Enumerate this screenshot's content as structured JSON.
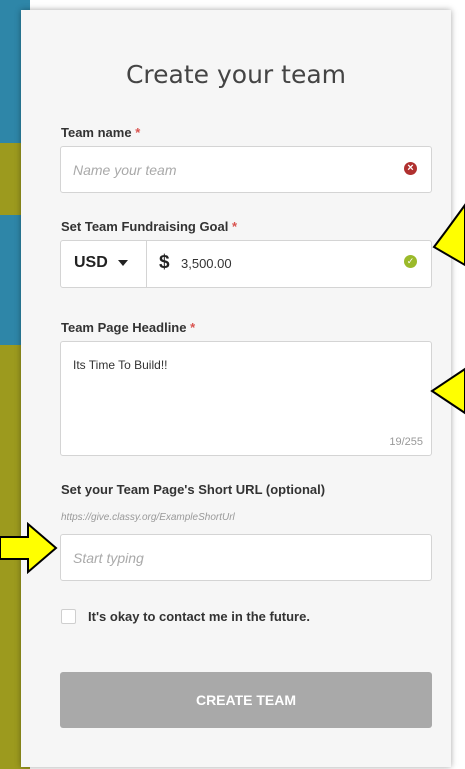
{
  "modal": {
    "title": "Create your team",
    "team_name": {
      "label": "Team name",
      "required": "*",
      "placeholder": "Name your team",
      "status_icon": "error-x-icon"
    },
    "goal": {
      "label": "Set Team Fundraising Goal",
      "required": "*",
      "currency": "USD",
      "symbol": "$",
      "amount": "3,500.00",
      "status_icon": "check-icon"
    },
    "headline": {
      "label": "Team Page Headline",
      "required": "*",
      "value": "Its Time To Build!!",
      "counter": "19/255"
    },
    "short_url": {
      "label": "Set your Team Page's Short URL (optional)",
      "hint": "https://give.classy.org/ExampleShortUrl",
      "placeholder": "Start typing"
    },
    "contact_opt_in": {
      "label": "It's okay to contact me in the future.",
      "checked": false
    },
    "submit_label": "CREATE TEAM"
  },
  "colors": {
    "required": "#d9534f",
    "error_icon": "#b0302f",
    "ok_icon": "#9bba2a",
    "submit_disabled": "#a9a9a9",
    "annotation_arrow": "#ffff00"
  }
}
